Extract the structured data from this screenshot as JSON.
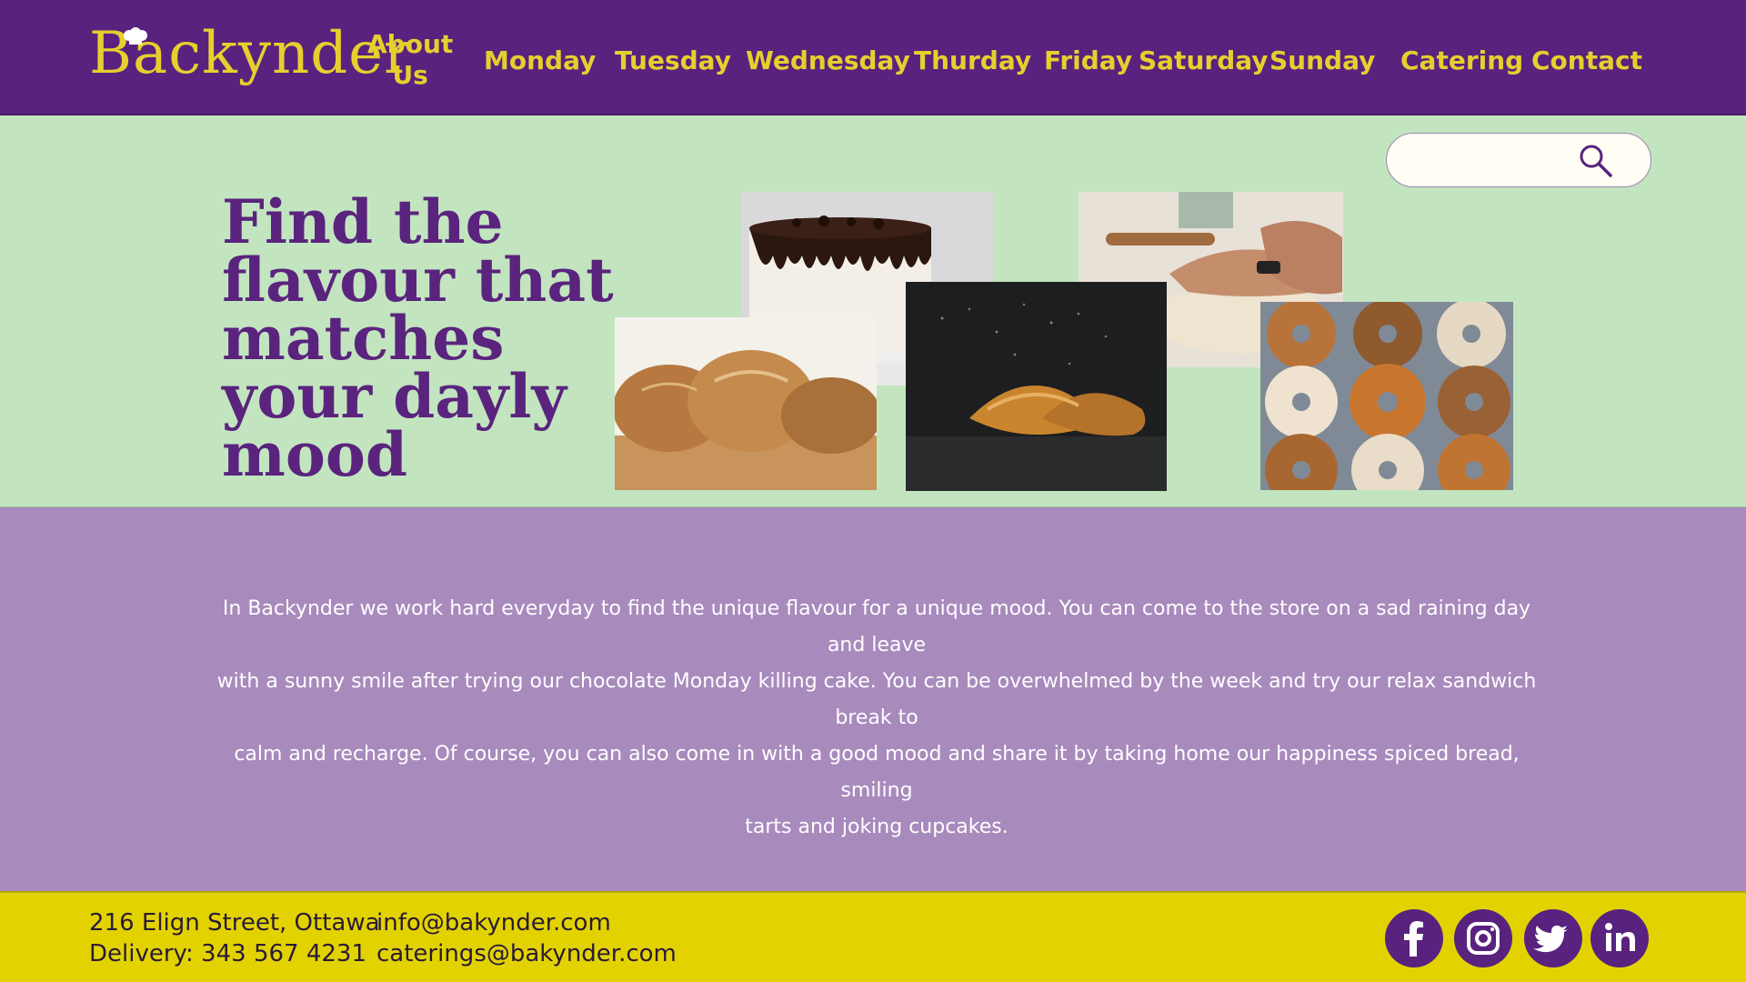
{
  "brand": {
    "name": "Backynder",
    "logo_icon": "chef-hat-icon",
    "brand_purple": "#58227e",
    "brand_yellow": "#e6cf2e"
  },
  "nav": {
    "about": [
      "About",
      "Us"
    ],
    "items": [
      "Monday",
      "Tuesday",
      "Wednesday",
      "Thurday",
      "Friday",
      "Saturday",
      "Sunday",
      "Catering",
      "Contact"
    ]
  },
  "search": {
    "placeholder": "",
    "icon": "search-icon"
  },
  "hero": {
    "headline_lines": [
      "Find the",
      "flavour that",
      "matches",
      "your dayly",
      "mood"
    ],
    "images": [
      "bread-loaves-photo",
      "drip-cake-photo",
      "croissant-photo",
      "kneading-dough-photo",
      "bagels-photo"
    ],
    "background": "#c2e5c0"
  },
  "about": {
    "lines": [
      "In Backynder we work hard everyday to find the unique flavour for a unique mood. You can come to the store on a sad raining day and leave",
      "with a sunny smile after trying our chocolate Monday killing cake. You can be overwhelmed by the week and try our relax sandwich break to",
      "calm and recharge. Of course,  you can also come in with a good mood and share it by taking home our happiness spiced bread, smiling",
      "tarts and  joking cupcakes."
    ],
    "background": "#a88abd"
  },
  "footer": {
    "address": "216 Elign Street, Ottawa",
    "delivery": "Delivery: 343 567 4231",
    "email": "info@bakynder.com",
    "catering_email": "caterings@bakynder.com",
    "social": [
      "facebook-icon",
      "instagram-icon",
      "twitter-icon",
      "linkedin-icon"
    ],
    "background": "#e2d300"
  }
}
